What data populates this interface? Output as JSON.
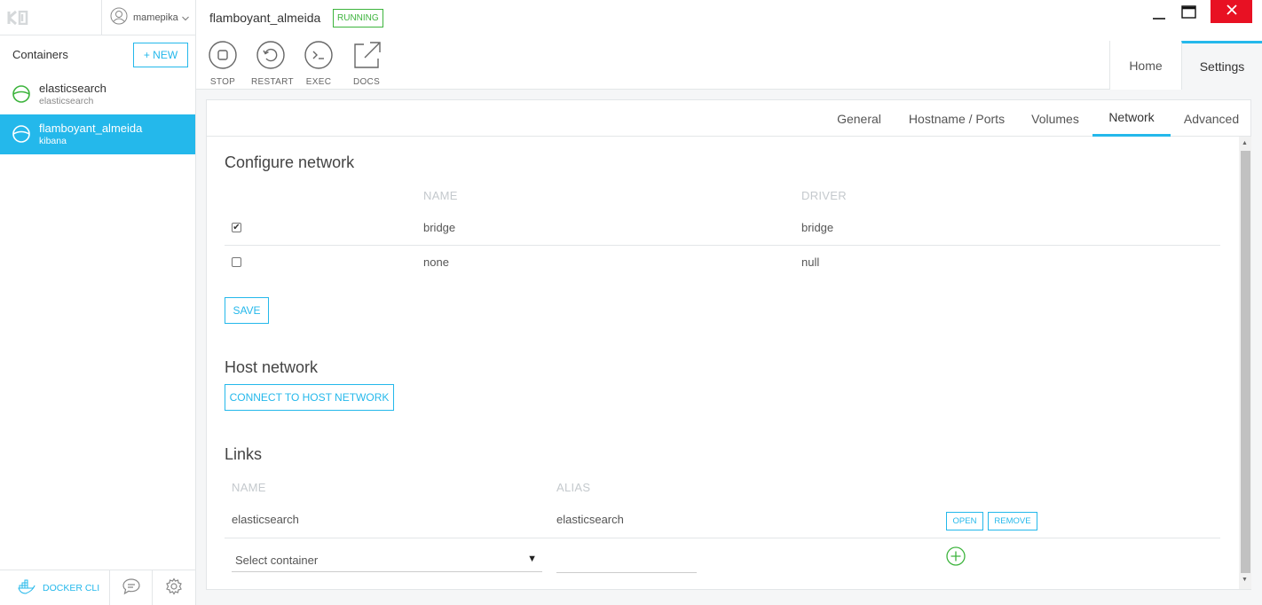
{
  "sidebar": {
    "user": {
      "name": "mamepika"
    },
    "title": "Containers",
    "new_button": "+ NEW",
    "containers": [
      {
        "name": "elasticsearch",
        "image": "elasticsearch",
        "status": "running",
        "selected": false
      },
      {
        "name": "flamboyant_almeida",
        "image": "kibana",
        "status": "running",
        "selected": true
      }
    ],
    "footer": {
      "docker_cli": "DOCKER CLI"
    }
  },
  "header": {
    "container_name": "flamboyant_almeida",
    "state": "RUNNING",
    "actions": [
      {
        "label": "STOP",
        "icon": "stop-icon"
      },
      {
        "label": "RESTART",
        "icon": "restart-icon"
      },
      {
        "label": "EXEC",
        "icon": "terminal-icon"
      },
      {
        "label": "DOCS",
        "icon": "external-link-icon"
      }
    ],
    "tabs": [
      {
        "label": "Home",
        "active": false
      },
      {
        "label": "Settings",
        "active": true
      }
    ]
  },
  "settings": {
    "subtabs": [
      {
        "label": "General",
        "active": false
      },
      {
        "label": "Hostname / Ports",
        "active": false
      },
      {
        "label": "Volumes",
        "active": false
      },
      {
        "label": "Network",
        "active": true
      },
      {
        "label": "Advanced",
        "active": false
      }
    ],
    "configure_network": {
      "title": "Configure network",
      "columns": {
        "name": "NAME",
        "driver": "DRIVER"
      },
      "rows": [
        {
          "name": "bridge",
          "driver": "bridge",
          "checked": true
        },
        {
          "name": "none",
          "driver": "null",
          "checked": false
        }
      ],
      "save_label": "SAVE"
    },
    "host_network": {
      "title": "Host network",
      "button": "CONNECT TO HOST NETWORK"
    },
    "links": {
      "title": "Links",
      "columns": {
        "name": "NAME",
        "alias": "ALIAS"
      },
      "rows": [
        {
          "name": "elasticsearch",
          "alias": "elasticsearch",
          "open": "OPEN",
          "remove": "REMOVE"
        }
      ],
      "new_link": {
        "select_placeholder": "Select container",
        "alias_value": ""
      }
    }
  },
  "colors": {
    "accent": "#24b8eb",
    "running": "#3db43d",
    "close": "#e81123"
  }
}
